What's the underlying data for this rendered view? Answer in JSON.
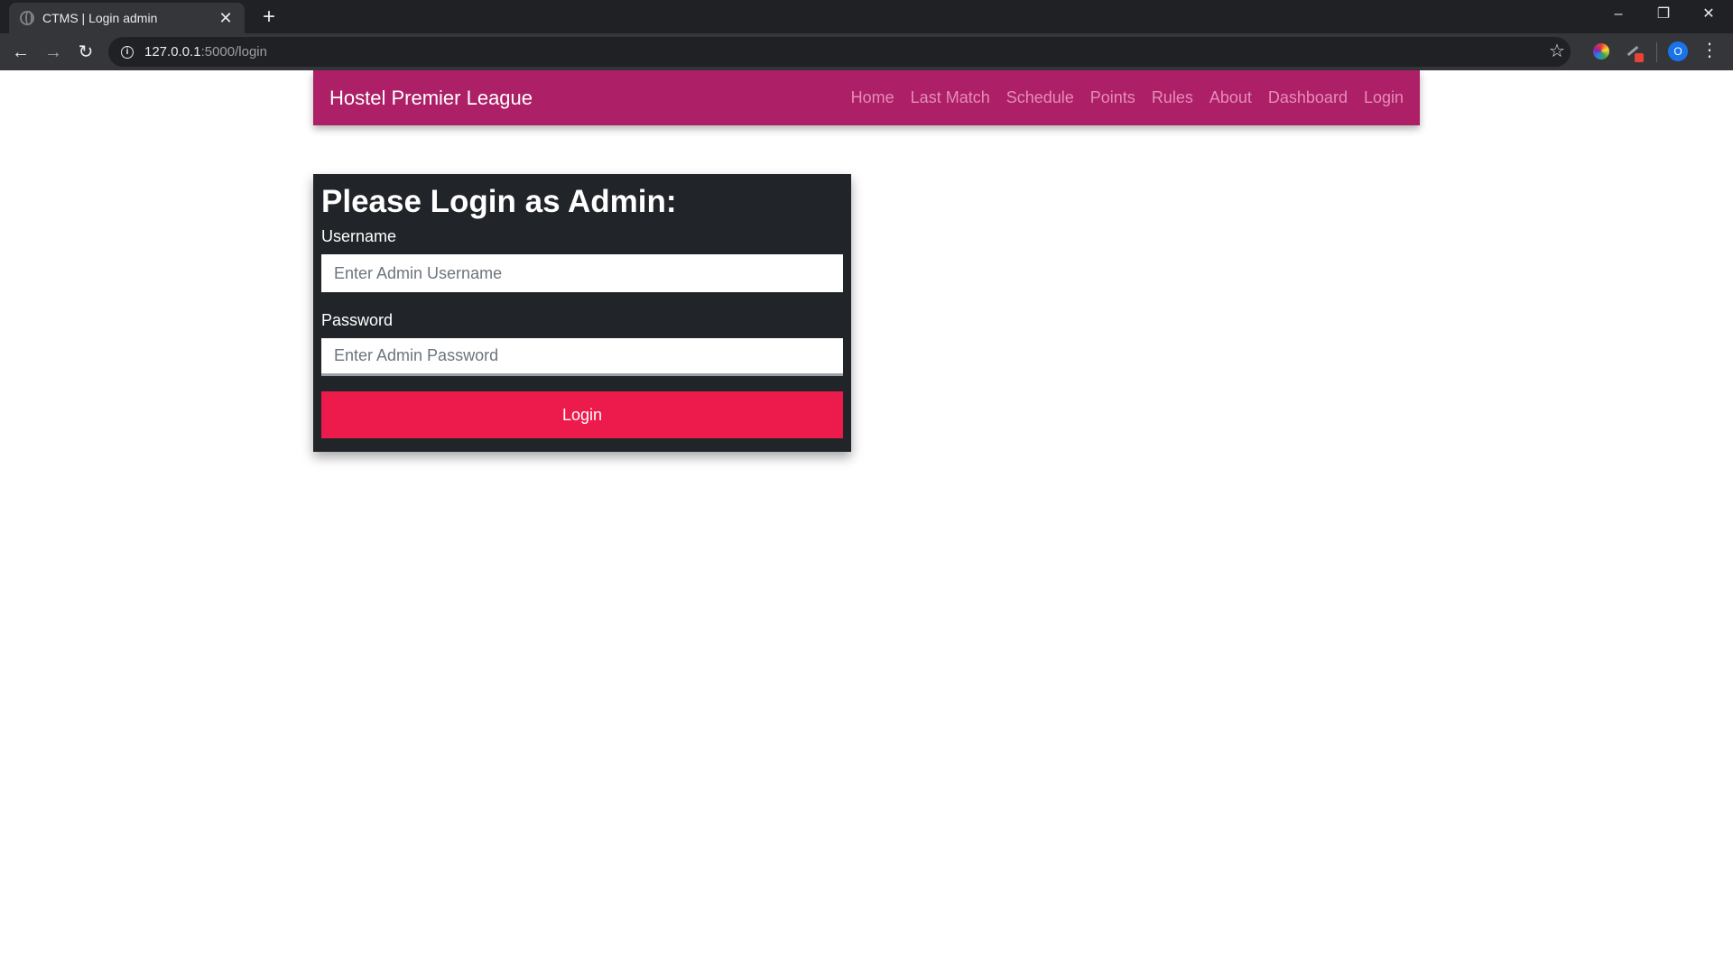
{
  "browser": {
    "tab_title": "CTMS | Login admin",
    "tab_close": "✕",
    "new_tab": "+",
    "url_host": "127.0.0.1",
    "url_path": ":5000/login",
    "back": "←",
    "forward": "→",
    "reload": "↻",
    "bookmark": "☆",
    "profile_initial": "O",
    "menu": "⋮",
    "minimize": "–",
    "restore": "❐",
    "close": "✕"
  },
  "navbar": {
    "brand": "Hostel Premier League",
    "links": [
      "Home",
      "Last Match",
      "Schedule",
      "Points",
      "Rules",
      "About",
      "Dashboard",
      "Login"
    ]
  },
  "login": {
    "heading": "Please Login as Admin:",
    "username_label": "Username",
    "username_placeholder": "Enter Admin Username",
    "password_label": "Password",
    "password_placeholder": "Enter Admin Password",
    "submit_label": "Login"
  },
  "colors": {
    "navbar_bg": "#ad1f66",
    "card_bg": "#212428",
    "button_bg": "#ed1b4b"
  }
}
